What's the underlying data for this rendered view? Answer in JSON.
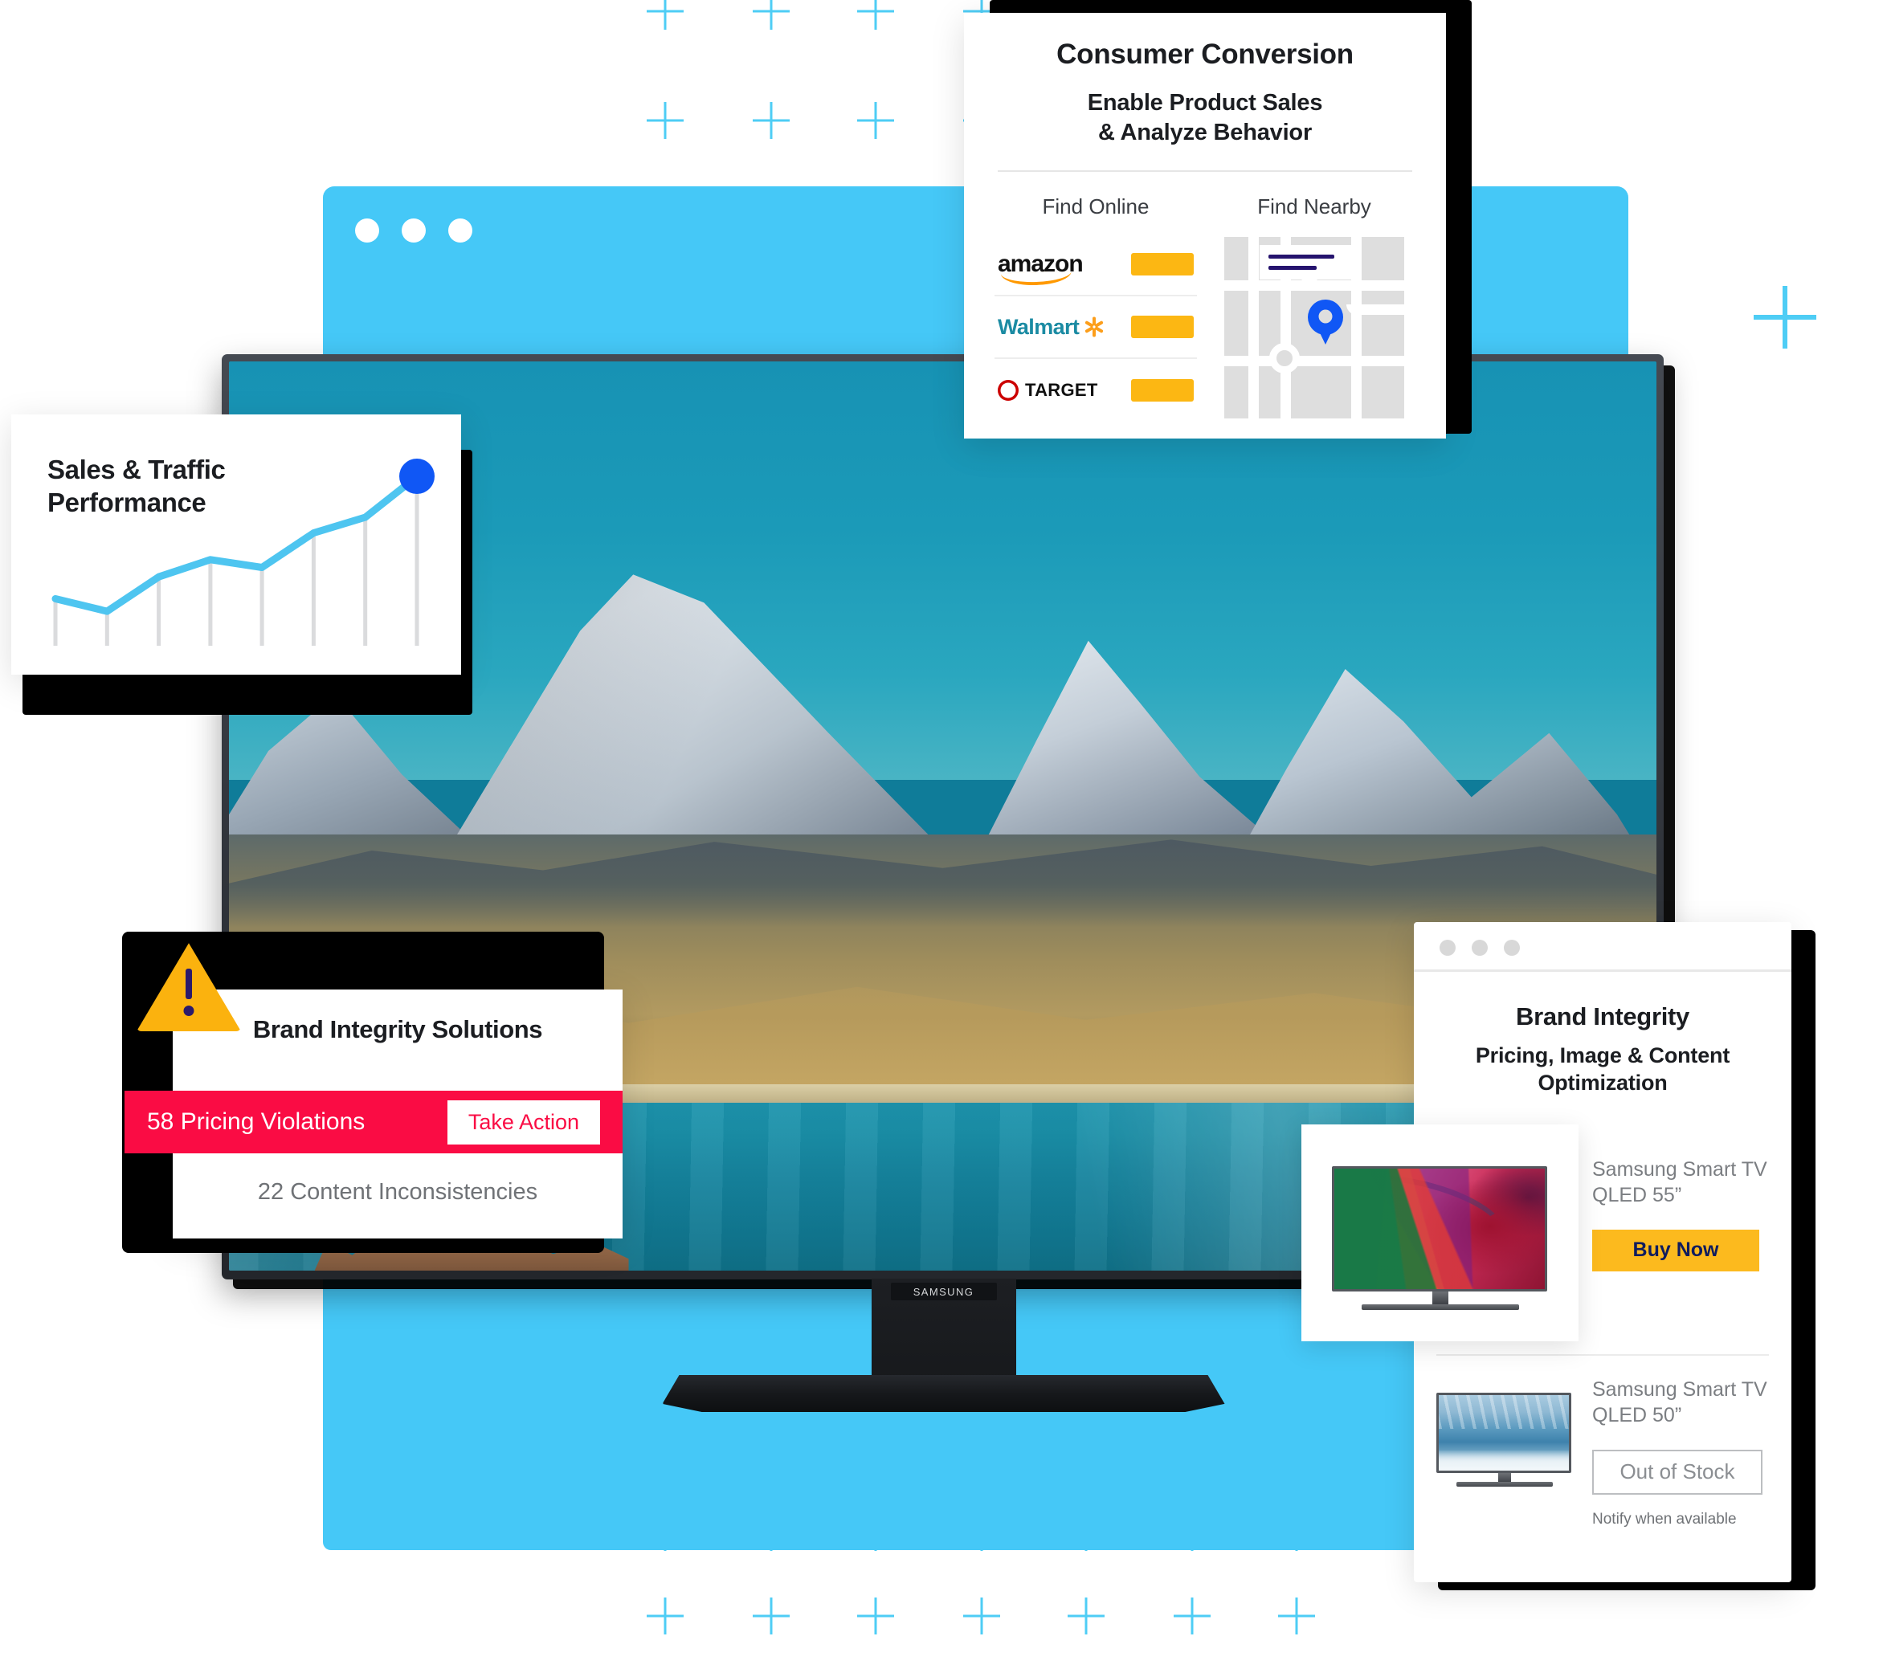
{
  "colors": {
    "brand_blue": "#45C8F7",
    "accent_blue": "#1057F5",
    "alert_red": "#FA0C44",
    "amber": "#FCB713",
    "buy_yellow": "#FCBA1E",
    "navy": "#101C5E",
    "warning_yellow": "#FBB20E"
  },
  "browser_window": {
    "dots": [
      "dot-1",
      "dot-2",
      "dot-3"
    ]
  },
  "tv": {
    "brand_label": "SAMSUNG",
    "screen_scene": "mountain-lake-landscape"
  },
  "consumer_conversion": {
    "title": "Consumer Conversion",
    "subtitle_line1": "Enable Product Sales",
    "subtitle_line2": "& Analyze Behavior",
    "columns": [
      {
        "heading": "Find Online"
      },
      {
        "heading": "Find Nearby"
      }
    ],
    "retailers": [
      {
        "name": "amazon",
        "action_label": ""
      },
      {
        "name": "Walmart",
        "action_label": ""
      },
      {
        "name": "TARGET",
        "action_label": ""
      }
    ],
    "map": {
      "pin_icon": "map-pin-icon",
      "popup_lines": 2
    }
  },
  "sales_traffic": {
    "title_line1": "Sales & Traffic",
    "title_line2": "Performance"
  },
  "chart_data": {
    "type": "line",
    "title": "Sales & Traffic Performance",
    "x": [
      1,
      2,
      3,
      4,
      5,
      6,
      7,
      8
    ],
    "categories": [
      "1",
      "2",
      "3",
      "4",
      "5",
      "6",
      "7",
      "8"
    ],
    "values": [
      30,
      22,
      44,
      55,
      50,
      72,
      82,
      108
    ],
    "ylim": [
      0,
      120
    ],
    "xlabel": "",
    "ylabel": "",
    "grid": false,
    "legend": "none",
    "series": [
      {
        "name": "Sales & Traffic",
        "values": [
          30,
          22,
          44,
          55,
          50,
          72,
          82,
          108
        ],
        "color": "#4EC5F0"
      }
    ],
    "marker": {
      "index": 7,
      "value": 108,
      "color": "#1057F5"
    },
    "bars": {
      "color": "#DADBDD",
      "count": 8
    }
  },
  "brand_integrity_solutions": {
    "title": "Brand Integrity Solutions",
    "warning_icon": "warning-triangle-icon",
    "alert": {
      "text": "58 Pricing Violations",
      "button_label": "Take Action"
    },
    "secondary_text": "22 Content Inconsistencies"
  },
  "brand_integrity_panel": {
    "title": "Brand Integrity",
    "subtitle_line1": "Pricing, Image & Content",
    "subtitle_line2": "Optimization",
    "dots": [
      "dot-1",
      "dot-2",
      "dot-3"
    ],
    "products": [
      {
        "name_line1": "Samsung Smart TV",
        "name_line2": "QLED 55”",
        "cta_label": "Buy Now",
        "cta_style": "primary",
        "note": ""
      },
      {
        "name_line1": "Samsung Smart TV",
        "name_line2": "QLED 50”",
        "cta_label": "Out of Stock",
        "cta_style": "disabled",
        "note": "Notify when available"
      }
    ]
  }
}
